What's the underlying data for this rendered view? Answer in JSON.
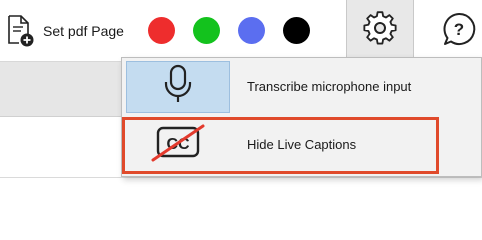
{
  "toolbar": {
    "pdf_button_label": "Set pdf Page",
    "pdf_button_icon": "document-add-icon",
    "colors": [
      {
        "name": "red",
        "hex": "#ee2d2d"
      },
      {
        "name": "green",
        "hex": "#13c21d"
      },
      {
        "name": "blue",
        "hex": "#5b6ef0"
      },
      {
        "name": "black",
        "hex": "#000000"
      }
    ],
    "settings_icon": "gear-icon",
    "help_icon": "help-icon",
    "help_glyph": "?"
  },
  "menu": {
    "items": [
      {
        "label": "Transcribe microphone input",
        "icon": "microphone-icon"
      },
      {
        "label": "Hide Live Captions",
        "icon": "closed-captions-off-icon",
        "icon_text": "CC"
      }
    ]
  },
  "annotation": {
    "highlight_color": "#e04a2b"
  }
}
